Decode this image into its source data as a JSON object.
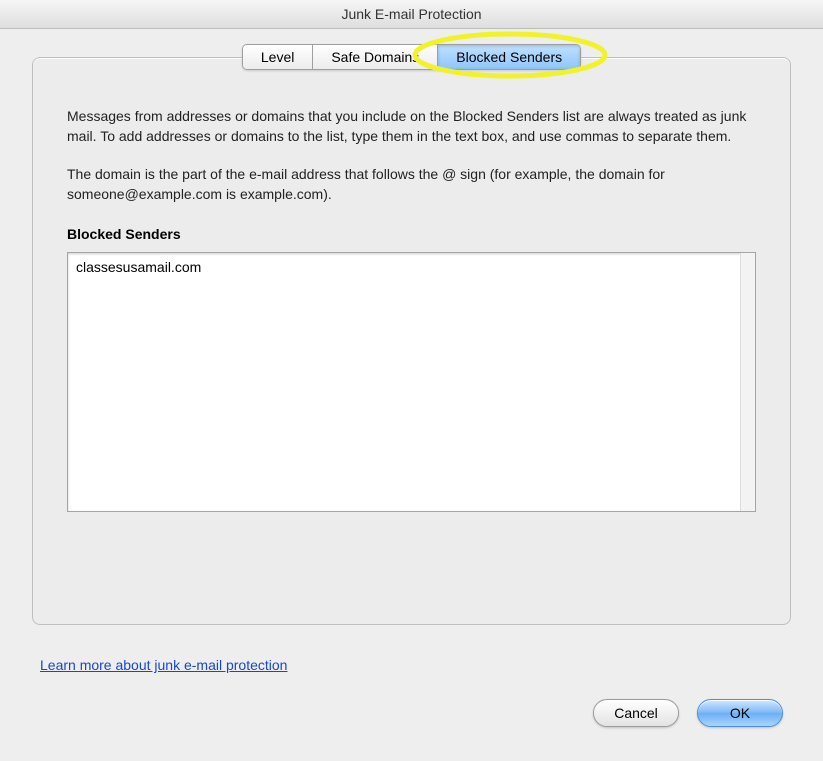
{
  "window": {
    "title": "Junk E-mail Protection"
  },
  "tabs": {
    "level": "Level",
    "safe_domains": "Safe Domains",
    "blocked_senders": "Blocked Senders"
  },
  "main": {
    "paragraph1": "Messages from addresses or domains that you include on the Blocked Senders list are always treated as junk mail. To add addresses or domains to the list, type them in the text box, and use commas to separate them.",
    "paragraph2": "The domain is the part of the e-mail address that follows the @ sign (for example, the domain for someone@example.com is example.com).",
    "label": "Blocked Senders",
    "textarea_value": "classesusamail.com"
  },
  "footer": {
    "link": "Learn more about junk e-mail protection",
    "cancel": "Cancel",
    "ok": "OK"
  }
}
